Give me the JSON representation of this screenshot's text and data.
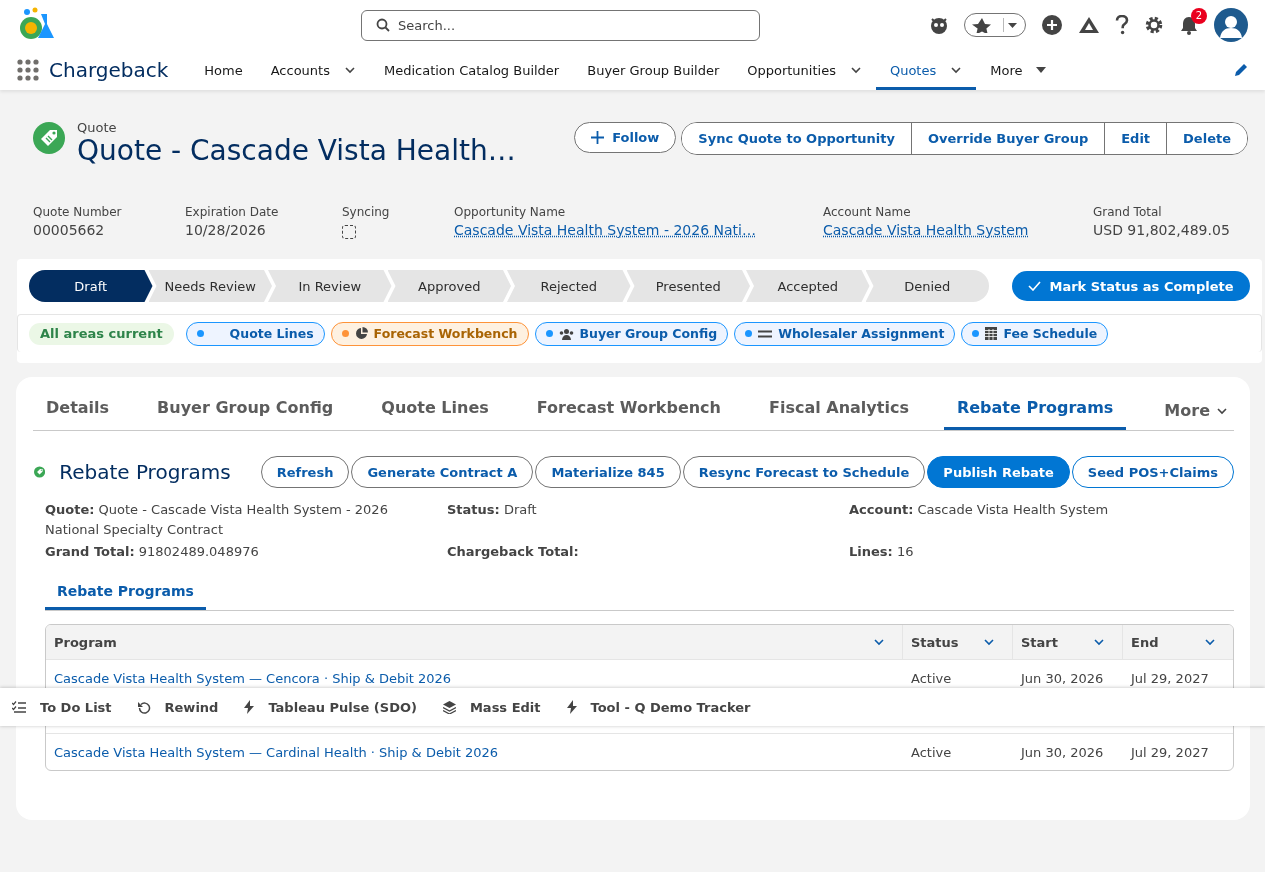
{
  "app": {
    "name": "Chargeback"
  },
  "search": {
    "placeholder": "Search..."
  },
  "notifications": {
    "count": "2"
  },
  "nav": [
    {
      "label": "Home",
      "selected": false,
      "menu": false
    },
    {
      "label": "Accounts",
      "selected": false,
      "menu": true
    },
    {
      "label": "Medication Catalog Builder",
      "selected": false,
      "menu": false
    },
    {
      "label": "Buyer Group Builder",
      "selected": false,
      "menu": false
    },
    {
      "label": "Opportunities",
      "selected": false,
      "menu": true
    },
    {
      "label": "Quotes",
      "selected": true,
      "menu": true
    }
  ],
  "nav_more": "More",
  "record": {
    "type": "Quote",
    "title": "Quote - Cascade Vista Health…",
    "follow": "Follow",
    "actions": [
      "Sync Quote to Opportunity",
      "Override Buyer Group",
      "Edit",
      "Delete"
    ]
  },
  "fields": [
    {
      "kind": "text",
      "label": "Quote Number",
      "value": "00005662"
    },
    {
      "kind": "text",
      "label": "Expiration Date",
      "value": "10/28/2026"
    },
    {
      "kind": "checkbox",
      "label": "Syncing",
      "checked": false
    },
    {
      "kind": "link",
      "label": "Opportunity Name",
      "value": "Cascade Vista Health System - 2026 Nati…"
    },
    {
      "kind": "link",
      "label": "Account Name",
      "value": "Cascade Vista Health System"
    },
    {
      "kind": "text",
      "label": "Grand Total",
      "value": "USD 91,802,489.05"
    }
  ],
  "path": {
    "stages": [
      {
        "label": "Draft",
        "selected": true
      },
      {
        "label": "Needs Review",
        "selected": false
      },
      {
        "label": "In Review",
        "selected": false
      },
      {
        "label": "Approved",
        "selected": false
      },
      {
        "label": "Rejected",
        "selected": false
      },
      {
        "label": "Presented",
        "selected": false
      },
      {
        "label": "Accepted",
        "selected": false
      },
      {
        "label": "Denied",
        "selected": false
      }
    ],
    "complete_button": "Mark Status as Complete"
  },
  "areas": {
    "status": "All areas current",
    "chips": [
      {
        "label": "Quote Lines",
        "kind": "info",
        "color": "#1b96ff"
      },
      {
        "label": "Forecast Workbench",
        "kind": "warning",
        "color": "#fe9339"
      },
      {
        "label": "Buyer Group Config",
        "kind": "info",
        "color": "#1b96ff"
      },
      {
        "label": "Wholesaler Assignment",
        "kind": "info",
        "color": "#1b96ff"
      },
      {
        "label": "Fee Schedule",
        "kind": "info",
        "color": "#1b96ff"
      }
    ]
  },
  "tabs": [
    {
      "label": "Details",
      "selected": false
    },
    {
      "label": "Buyer Group Config",
      "selected": false
    },
    {
      "label": "Quote Lines",
      "selected": false
    },
    {
      "label": "Forecast Workbench",
      "selected": false
    },
    {
      "label": "Fiscal Analytics",
      "selected": false
    },
    {
      "label": "Rebate Programs",
      "selected": true
    }
  ],
  "tabs_more": "More",
  "rebate": {
    "title": "Rebate Programs",
    "buttons": [
      {
        "label": "Refresh",
        "kind": "neutral"
      },
      {
        "label": "Generate Contract A",
        "kind": "neutral"
      },
      {
        "label": "Materialize 845",
        "kind": "neutral"
      },
      {
        "label": "Resync Forecast to Schedule",
        "kind": "neutral"
      },
      {
        "label": "Publish Rebate",
        "kind": "brand"
      },
      {
        "label": "Seed POS+Claims",
        "kind": "outline"
      }
    ]
  },
  "summary": [
    {
      "label": "Quote:",
      "value": "Quote - Cascade Vista Health System - 2026 National Specialty Contract"
    },
    {
      "label": "Status:",
      "value": "Draft"
    },
    {
      "label": "Account:",
      "value": "Cascade Vista Health System"
    },
    {
      "label": "Grand Total:",
      "value": "91802489.048976"
    },
    {
      "label": "Chargeback Total:"
    },
    {
      "label": "Lines:",
      "value": "16"
    }
  ],
  "subtabs": [
    {
      "label": "Rebate Programs",
      "selected": true
    }
  ],
  "table": {
    "columns": [
      "Program",
      "Status",
      "Start",
      "End"
    ],
    "rows": [
      [
        "Cascade Vista Health System — Cencora · Ship & Debit 2026",
        "Active",
        "Jun 30, 2026",
        "Jul 29, 2027"
      ],
      [
        "Cascade Vista Health System — Cardinal Health · Ship & Debit 2026",
        "Active",
        "Jun 30, 2026",
        "Jul 29, 2027"
      ]
    ]
  },
  "utility_bar": [
    {
      "label": "To Do List"
    },
    {
      "label": "Rewind"
    },
    {
      "label": "Tableau Pulse (SDO)"
    },
    {
      "label": "Mass Edit"
    },
    {
      "label": "Tool - Q Demo Tracker"
    }
  ]
}
